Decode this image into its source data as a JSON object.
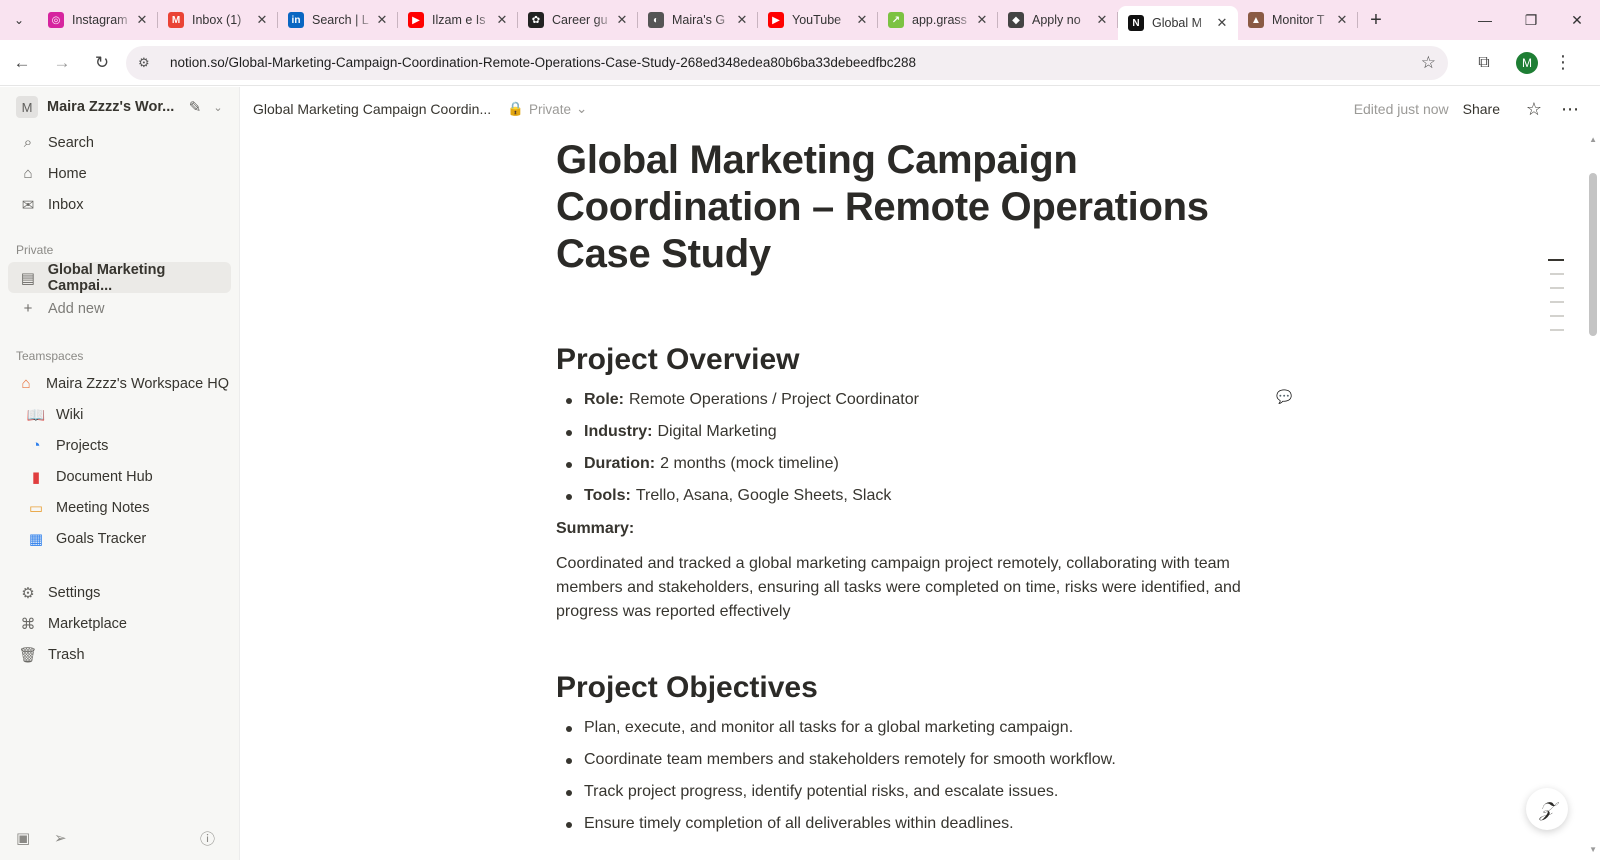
{
  "browser": {
    "tabs": [
      {
        "title": "Instagram",
        "favicon_color": "#d6249f",
        "favicon_glyph": "◎"
      },
      {
        "title": "Inbox (1)",
        "favicon_color": "#ea4335",
        "favicon_glyph": "M"
      },
      {
        "title": "Search | L",
        "favicon_color": "#0a66c2",
        "favicon_glyph": "in"
      },
      {
        "title": "Ilzam e Is",
        "favicon_color": "#ff0000",
        "favicon_glyph": "▶"
      },
      {
        "title": "Career gu",
        "favicon_color": "#222222",
        "favicon_glyph": "✿"
      },
      {
        "title": "Maira's G",
        "favicon_color": "#555555",
        "favicon_glyph": "◐"
      },
      {
        "title": "YouTube",
        "favicon_color": "#ff0000",
        "favicon_glyph": "▶"
      },
      {
        "title": "app.grass",
        "favicon_color": "#7cc242",
        "favicon_glyph": "↗"
      },
      {
        "title": "Apply no",
        "favicon_color": "#444444",
        "favicon_glyph": "◆"
      },
      {
        "title": "Global M",
        "favicon_color": "#111111",
        "favicon_glyph": "N",
        "active": true
      },
      {
        "title": "Monitor T",
        "favicon_color": "#8a5a44",
        "favicon_glyph": "▲"
      }
    ],
    "url": "notion.so/Global-Marketing-Campaign-Coordination-Remote-Operations-Case-Study-268ed348edea80b6ba33debeedfbc288",
    "profile_initial": "M"
  },
  "sidebar": {
    "workspace_initial": "M",
    "workspace_name": "Maira Zzzz's Wor...",
    "top_items": [
      {
        "label": "Search",
        "icon": "search-icon"
      },
      {
        "label": "Home",
        "icon": "home-icon"
      },
      {
        "label": "Inbox",
        "icon": "inbox-icon"
      }
    ],
    "private_label": "Private",
    "private_items": [
      {
        "label": "Global Marketing Campai...",
        "icon": "page-icon"
      }
    ],
    "add_new": "Add new",
    "teamspaces_label": "Teamspaces",
    "teamspace_name": "Maira Zzzz's Workspace HQ",
    "teamspace_items": [
      {
        "label": "Wiki",
        "icon": "wiki-icon"
      },
      {
        "label": "Projects",
        "icon": "projects-icon"
      },
      {
        "label": "Document Hub",
        "icon": "document-hub-icon"
      },
      {
        "label": "Meeting Notes",
        "icon": "meeting-notes-icon"
      },
      {
        "label": "Goals Tracker",
        "icon": "goals-tracker-icon"
      }
    ],
    "bottom_items": [
      {
        "label": "Settings",
        "icon": "gear-icon"
      },
      {
        "label": "Marketplace",
        "icon": "marketplace-icon"
      },
      {
        "label": "Trash",
        "icon": "trash-icon"
      }
    ]
  },
  "topbar": {
    "breadcrumb": "Global Marketing Campaign Coordin...",
    "privacy": "Private",
    "edited": "Edited just now",
    "share": "Share"
  },
  "page": {
    "title": "Global Marketing Campaign Coordination – Remote Operations Case Study",
    "overview_heading": "Project Overview",
    "overview_items": [
      {
        "label": "Role:",
        "value": "Remote Operations / Project Coordinator"
      },
      {
        "label": "Industry:",
        "value": "Digital Marketing"
      },
      {
        "label": "Duration:",
        "value": "2 months (mock timeline)"
      },
      {
        "label": "Tools:",
        "value": "Trello, Asana, Google Sheets, Slack"
      }
    ],
    "summary_label": "Summary:",
    "summary_text": "Coordinated and tracked a global marketing campaign project remotely, collaborating with team members and stakeholders, ensuring all tasks were completed on time, risks were identified, and progress was reported effectively",
    "objectives_heading": "Project Objectives",
    "objectives": [
      "Plan, execute, and monitor all tasks for a global marketing campaign.",
      "Coordinate team members and stakeholders remotely for smooth workflow.",
      "Track project progress, identify potential risks, and escalate issues.",
      "Ensure timely completion of all deliverables within deadlines."
    ]
  }
}
